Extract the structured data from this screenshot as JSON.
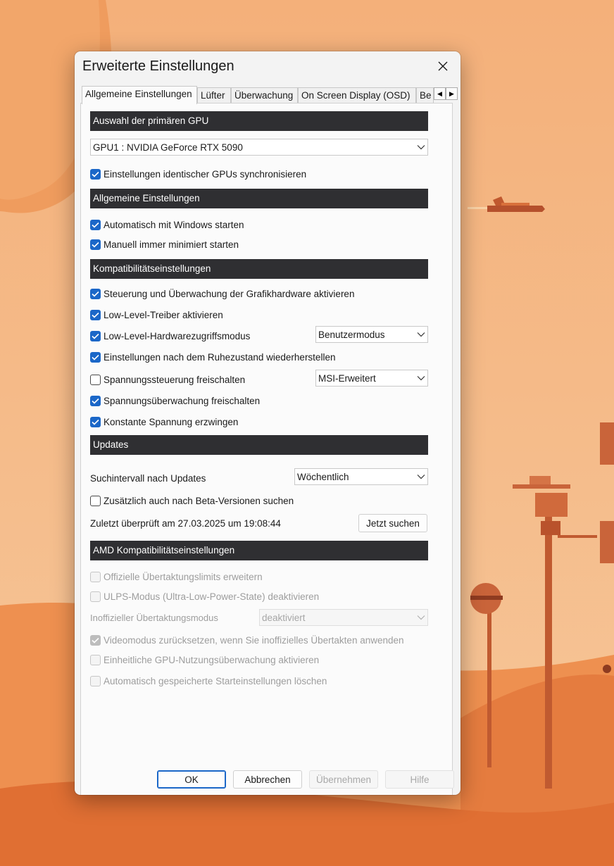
{
  "window": {
    "title": "Erweiterte Einstellungen"
  },
  "tabs": [
    {
      "label": "Allgemeine Einstellungen",
      "active": true
    },
    {
      "label": "Lüfter"
    },
    {
      "label": "Überwachung"
    },
    {
      "label": "On Screen Display (OSD)"
    },
    {
      "label": "Be"
    }
  ],
  "sections": {
    "gpu": "Auswahl der primären GPU",
    "general": "Allgemeine Einstellungen",
    "compat": "Kompatibilitätseinstellungen",
    "updates": "Updates",
    "amd": "AMD Kompatibilitätseinstellungen"
  },
  "gpu": {
    "selected": "GPU1 : NVIDIA GeForce RTX 5090",
    "sync_label": "Einstellungen identischer GPUs synchronisieren",
    "sync_checked": true
  },
  "general": {
    "autostart": "Automatisch mit Windows starten",
    "minimized": "Manuell immer minimiert starten"
  },
  "compat": {
    "hw_control": "Steuerung und Überwachung der Grafikhardware aktivieren",
    "lowlevel_driver": "Low-Level-Treiber aktivieren",
    "lowlevel_hw": "Low-Level-Hardwarezugriffsmodus",
    "lowlevel_hw_mode": "Benutzermodus",
    "restore_after_sleep": "Einstellungen nach dem Ruhezustand wiederherstellen",
    "voltage_control": "Spannungssteuerung freischalten",
    "voltage_control_mode": "MSI-Erweitert",
    "voltage_monitor": "Spannungsüberwachung freischalten",
    "const_voltage": "Konstante Spannung erzwingen"
  },
  "updates": {
    "interval_label": "Suchintervall nach Updates",
    "interval_value": "Wöchentlich",
    "beta": "Zusätzlich auch nach Beta-Versionen suchen",
    "last_checked": "Zuletzt überprüft am 27.03.2025 um 19:08:44",
    "check_now": "Jetzt suchen"
  },
  "amd": {
    "extend_limits": "Offizielle Übertaktungslimits erweitern",
    "ulps": "ULPS-Modus (Ultra-Low-Power-State) deaktivieren",
    "unofficial_label": "Inoffizieller Übertaktungsmodus",
    "unofficial_value": "deaktiviert",
    "reset_video": "Videomodus zurücksetzen, wenn Sie inoffizielles Übertakten anwenden",
    "unified_monitoring": "Einheitliche GPU-Nutzungsüberwachung aktivieren",
    "delete_startup": "Automatisch gespeicherte Starteinstellungen löschen"
  },
  "buttons": {
    "ok": "OK",
    "cancel": "Abbrechen",
    "apply": "Übernehmen",
    "help": "Hilfe"
  },
  "colors": {
    "accent": "#1b67c8",
    "section_bg": "#2f2f32",
    "wallpaper_primary": "#f0a76a",
    "wallpaper_dune": "#e8783e"
  }
}
